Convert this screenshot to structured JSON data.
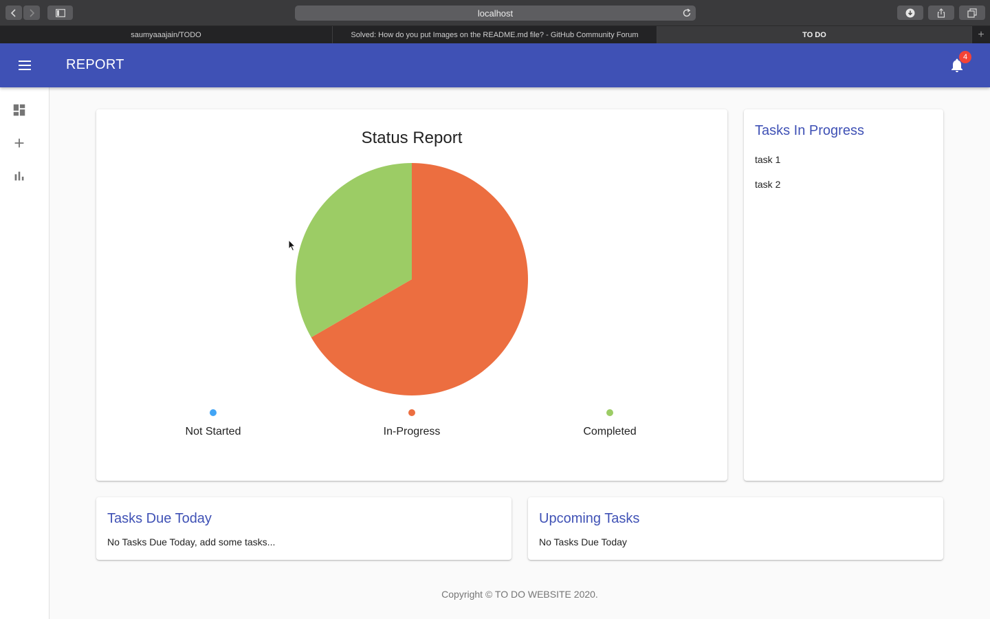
{
  "browser": {
    "url": "localhost",
    "tabs": [
      {
        "label": "saumyaaajain/TODO"
      },
      {
        "label": "Solved: How do you put Images on the README.md file? - GitHub Community Forum"
      },
      {
        "label": "TO DO"
      }
    ]
  },
  "appbar": {
    "title": "REPORT",
    "notification_count": "4",
    "color": "#3f51b5"
  },
  "sidebar": {
    "items": [
      {
        "icon": "dashboard-icon"
      },
      {
        "icon": "add-icon"
      },
      {
        "icon": "bar-chart-icon"
      }
    ]
  },
  "status_card": {
    "title": "Status Report"
  },
  "chart_data": {
    "type": "pie",
    "title": "Status Report",
    "categories": [
      "Not Started",
      "In-Progress",
      "Completed"
    ],
    "values": [
      0,
      2,
      1
    ],
    "colors": [
      "#42a5f5",
      "#ec6e40",
      "#9ccc65"
    ],
    "legend": "bottom"
  },
  "in_progress": {
    "title": "Tasks In Progress",
    "tasks": [
      "task 1",
      "task 2"
    ]
  },
  "due_today": {
    "title": "Tasks Due Today",
    "message": "No Tasks Due Today, add some tasks..."
  },
  "upcoming": {
    "title": "Upcoming Tasks",
    "message": "No Tasks Due Today"
  },
  "footer": {
    "copyright": "Copyright © TO DO WEBSITE 2020."
  }
}
